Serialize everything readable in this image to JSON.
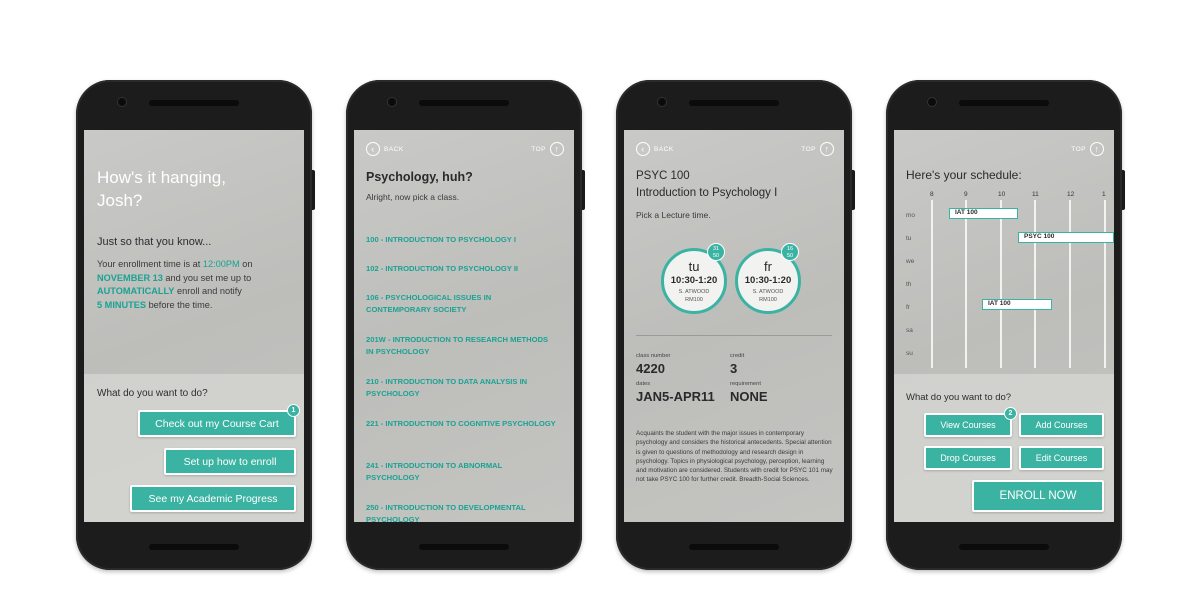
{
  "colors": {
    "accent": "#3bb3a3",
    "screen_bg": "#c4c4c1",
    "phone": "#1c1c1c"
  },
  "screen1": {
    "greeting_line1": "How's it hanging,",
    "greeting_line2": "Josh?",
    "subheading": "Just so that you know...",
    "para_p1": "Your enrollment time is at ",
    "para_time": "12:00PM",
    "para_p2": " on",
    "para_date": "NOVEMBER 13",
    "para_p3": " and you set me up to",
    "para_auto": "AUTOMATICALLY",
    "para_p4": " enroll and notify",
    "para_mins": "5 MINUTES",
    "para_p5": " before the time.",
    "question": "What do you want to do?",
    "btn_cart": "Check out my Course Cart",
    "cart_badge": "1",
    "btn_enroll": "Set up how to enroll",
    "btn_progress": "See my Academic Progress"
  },
  "nav": {
    "back": "BACK",
    "top": "TOP",
    "back_icon": "arrow-left-icon",
    "top_icon": "arrow-up-icon"
  },
  "screen2": {
    "title": "Psychology, huh?",
    "subtitle": "Alright, now pick a class.",
    "courses": [
      "100 - INTRODUCTION TO PSYCHOLOGY I",
      "102 - INTRODUCTION TO PSYCHOLOGY II",
      "106 - PSYCHOLOGICAL ISSUES IN CONTEMPORARY SOCIETY",
      "201W - INTRODUCTION TO RESEARCH METHODS IN PSYCHOLOGY",
      "210 - INTRODUCTION TO DATA ANALYSIS IN PSYCHOLOGY",
      "221 - INTRODUCTION TO COGNITIVE PSYCHOLOGY",
      "241 - INTRODUCTION TO ABNORMAL PSYCHOLOGY",
      "250 - INTRODUCTION TO DEVELOPMENTAL PSYCHOLOGY"
    ]
  },
  "screen3": {
    "code": "PSYC 100",
    "name": "Introduction to Psychology I",
    "prompt": "Pick a Lecture time.",
    "lectures": [
      {
        "day": "tu",
        "time": "10:30-1:20",
        "prof": "S. ATWOOD",
        "room": "RM100",
        "seats": "31",
        "cap": "50"
      },
      {
        "day": "fr",
        "time": "10:30-1:20",
        "prof": "S. ATWOOD",
        "room": "RM100",
        "seats": "16",
        "cap": "50"
      }
    ],
    "class_number_label": "class number",
    "class_number": "4220",
    "credit_label": "credit",
    "credit": "3",
    "dates_label": "dates",
    "dates": "JAN5-APR11",
    "requirement_label": "requirement",
    "requirement": "NONE",
    "description": "Acquaints the student with the major issues in contemporary psychology and considers the historical antecedents. Special attention is given to questions of methodology and research design in psychology. Topics in physiological psychology, perception, learning and motivation are considered. Students with credit for PSYC 101 may not take PSYC 100 for further credit. Breadth-Social Sciences."
  },
  "screen4": {
    "title": "Here's your schedule:",
    "hours": [
      "8",
      "9",
      "10",
      "11",
      "12",
      "1"
    ],
    "days": [
      "mo",
      "tu",
      "we",
      "th",
      "fr",
      "sa",
      "su"
    ],
    "blocks": [
      "IAT 100",
      "PSYC 100",
      "IAT 100"
    ],
    "question": "What do you want to do?",
    "btn_view": "View Courses",
    "view_badge": "2",
    "btn_add": "Add Courses",
    "btn_drop": "Drop Courses",
    "btn_edit": "Edit Courses",
    "btn_enroll_now": "ENROLL NOW"
  }
}
